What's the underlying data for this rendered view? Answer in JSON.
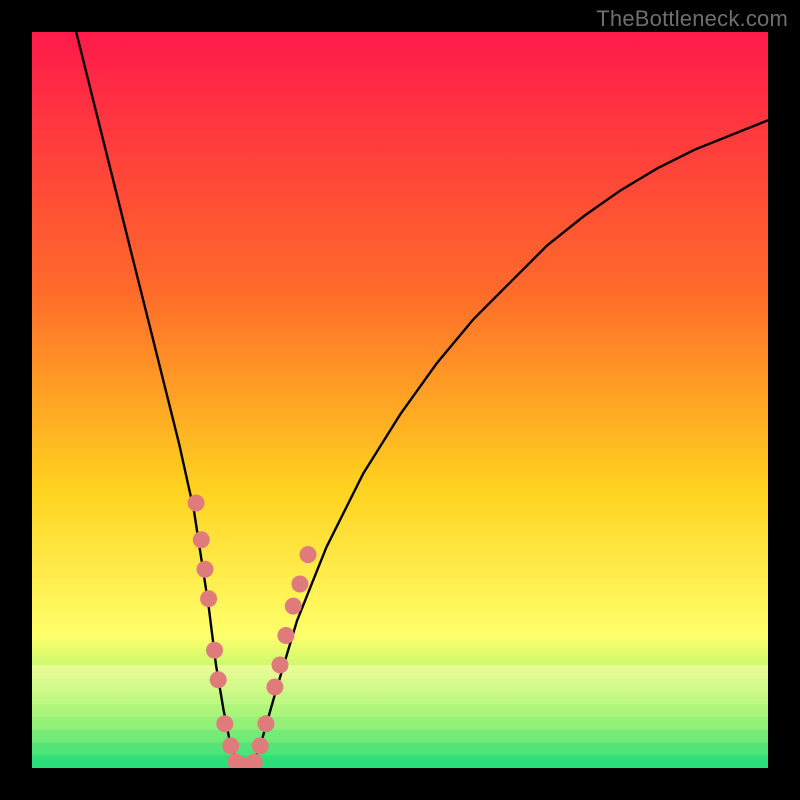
{
  "watermark": "TheBottleneck.com",
  "colors": {
    "gradient_top": "#ff1a4b",
    "gradient_mid1": "#ff6a2a",
    "gradient_mid2": "#ffd21f",
    "gradient_mid3": "#ffff6b",
    "gradient_bottom": "#1fe07a",
    "curve": "#000000",
    "dots": "#e07b7b",
    "frame": "#000000"
  },
  "chart_data": {
    "type": "line",
    "title": "",
    "xlabel": "",
    "ylabel": "",
    "xlim": [
      0,
      100
    ],
    "ylim": [
      0,
      100
    ],
    "series": [
      {
        "name": "bottleneck-curve",
        "x": [
          6,
          8,
          10,
          12,
          14,
          16,
          18,
          20,
          22,
          24,
          25,
          26,
          27,
          28,
          29,
          30,
          31,
          33,
          36,
          40,
          45,
          50,
          55,
          60,
          65,
          70,
          75,
          80,
          85,
          90,
          95,
          100
        ],
        "y": [
          100,
          92,
          84,
          76,
          68,
          60,
          52,
          44,
          35,
          22,
          14,
          8,
          3,
          0.5,
          0,
          0.5,
          3,
          10,
          20,
          30,
          40,
          48,
          55,
          61,
          66,
          71,
          75,
          78.5,
          81.5,
          84,
          86,
          88
        ]
      }
    ],
    "dots_left": [
      {
        "x": 22.3,
        "y": 36
      },
      {
        "x": 23.0,
        "y": 31
      },
      {
        "x": 23.5,
        "y": 27
      },
      {
        "x": 24.0,
        "y": 23
      },
      {
        "x": 24.8,
        "y": 16
      },
      {
        "x": 25.3,
        "y": 12
      },
      {
        "x": 26.2,
        "y": 6
      },
      {
        "x": 27.0,
        "y": 3
      }
    ],
    "dots_right": [
      {
        "x": 31.0,
        "y": 3
      },
      {
        "x": 31.8,
        "y": 6
      },
      {
        "x": 33.0,
        "y": 11
      },
      {
        "x": 33.7,
        "y": 14
      },
      {
        "x": 34.5,
        "y": 18
      },
      {
        "x": 35.5,
        "y": 22
      },
      {
        "x": 36.4,
        "y": 25
      },
      {
        "x": 37.5,
        "y": 29
      }
    ],
    "dots_bottom": [
      {
        "x": 27.7,
        "y": 0.8
      },
      {
        "x": 28.5,
        "y": 0.3
      },
      {
        "x": 29.3,
        "y": 0.3
      },
      {
        "x": 30.2,
        "y": 0.8
      }
    ]
  }
}
